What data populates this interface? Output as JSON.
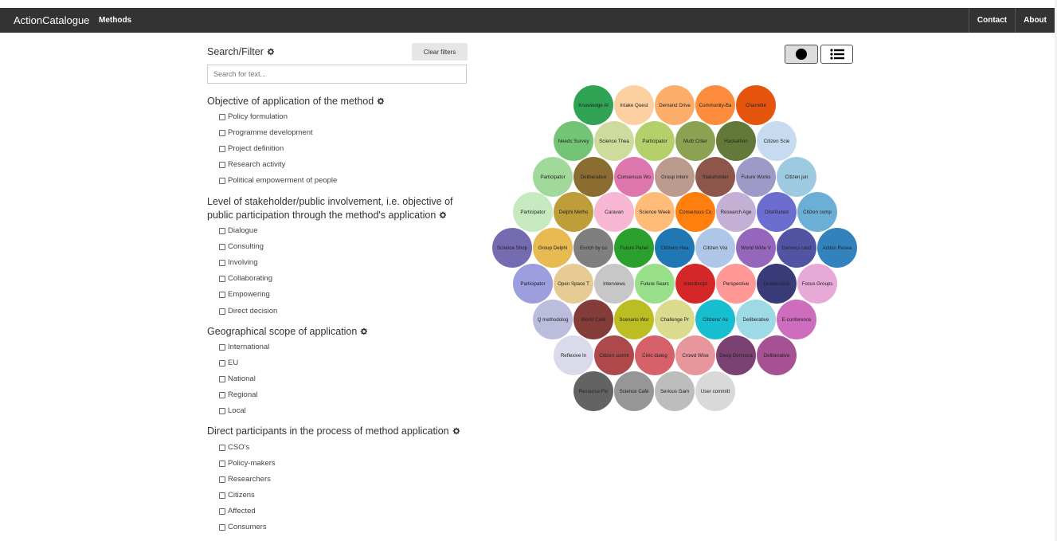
{
  "navbar": {
    "brand": "ActionCatalogue",
    "methods": "Methods",
    "contact": "Contact",
    "about": "About"
  },
  "filter": {
    "title": "Search/Filter",
    "clear": "Clear filters",
    "search_placeholder": "Search for text..."
  },
  "sections": [
    {
      "title": "Objective of application of the method",
      "options": [
        "Policy formulation",
        "Programme development",
        "Project definition",
        "Research activity",
        "Political empowerment of people"
      ]
    },
    {
      "title_line1": "Level of stakeholder/public involvement, i.e. objective of",
      "title_line2": "public participation through the method's application",
      "options": [
        "Dialogue",
        "Consulting",
        "Involving",
        "Collaborating",
        "Empowering",
        "Direct decision"
      ]
    },
    {
      "title": "Geographical scope of application",
      "options": [
        "International",
        "EU",
        "National",
        "Regional",
        "Local"
      ]
    },
    {
      "title": "Direct participants in the process of method application",
      "options": [
        "CSO's",
        "Policy-makers",
        "Researchers",
        "Citizens",
        "Affected",
        "Consumers"
      ]
    }
  ],
  "view_toggle": {
    "bubble_icon": "circle-icon",
    "list_icon": "list-icon"
  },
  "bubbles": {
    "rows": [
      [
        [
          "Knowledge Al",
          "#31a354"
        ],
        [
          "Intake Quest",
          "#fdd0a2"
        ],
        [
          "Demand Drive",
          "#fdae6b"
        ],
        [
          "Community-Ba",
          "#fd8d3c"
        ],
        [
          "Charrette",
          "#e6550d"
        ]
      ],
      [
        [
          "Needs Survey",
          "#74c476"
        ],
        [
          "Science Thea",
          "#cedb9c"
        ],
        [
          "Participator",
          "#b5cf6b"
        ],
        [
          "Multi Criter",
          "#8ca252"
        ],
        [
          "Hackathon",
          "#637939"
        ],
        [
          "Citizen Scie",
          "#c6dbef"
        ]
      ],
      [
        [
          "Participator",
          "#a1d99b"
        ],
        [
          "Deliberative",
          "#8c6d31"
        ],
        [
          "Consensus Wo",
          "#de77ae"
        ],
        [
          "Group interv",
          "#bc9b8f"
        ],
        [
          "Stakeholder",
          "#8c564b"
        ],
        [
          "Future Works",
          "#9e9ac8"
        ],
        [
          "Citizen jun",
          "#9ecae1"
        ]
      ],
      [
        [
          "Participator",
          "#c7e9c0"
        ],
        [
          "Delphi Metho",
          "#bd9e39"
        ],
        [
          "Caravan",
          "#f7b6d2"
        ],
        [
          "Science Week",
          "#ffbb78"
        ],
        [
          "Consensus Co",
          "#ff7f0e"
        ],
        [
          "Research Age",
          "#c5b0d5"
        ],
        [
          "Distributed",
          "#6b6ecf"
        ],
        [
          "Citizen comp",
          "#6baed6"
        ]
      ],
      [
        [
          "Science Shop",
          "#756bb1"
        ],
        [
          "Group Delphi",
          "#e7ba52"
        ],
        [
          "Enrich by co",
          "#7f7f7f"
        ],
        [
          "Future Panel",
          "#2ca02c"
        ],
        [
          "Citizens Hea",
          "#1f77b4"
        ],
        [
          "Citizen Visi",
          "#aec7e8"
        ],
        [
          "World Wide V",
          "#9467bd"
        ],
        [
          "Democs card",
          "#5254a3"
        ],
        [
          "Action Resea",
          "#3182bd"
        ]
      ],
      [
        [
          "Participator",
          "#9c9ede"
        ],
        [
          "Open Space T",
          "#e7cb94"
        ],
        [
          "Interviews",
          "#c7c7c7"
        ],
        [
          "Future Searc",
          "#98df8a"
        ],
        [
          "Interdiscipl",
          "#d62728"
        ],
        [
          "Perspective",
          "#ff9896"
        ],
        [
          "Deliberative",
          "#393b79"
        ],
        [
          "Focus Groups",
          "#e7a9d8"
        ]
      ],
      [
        [
          "Q methodolog",
          "#bcbddc"
        ],
        [
          "World Café",
          "#843c39"
        ],
        [
          "Scenario Wor",
          "#bcbd22"
        ],
        [
          "Challenge Pr",
          "#dbdb8d"
        ],
        [
          "Citizens' As",
          "#17becf"
        ],
        [
          "Deliberative",
          "#9edae5"
        ],
        [
          "E-conference",
          "#ce6dbd"
        ]
      ],
      [
        [
          "Reflexive In",
          "#dadaeb"
        ],
        [
          "Citizen summ",
          "#ad494a"
        ],
        [
          "Civic dialog",
          "#d6616b"
        ],
        [
          "Crowd Wise",
          "#e7969c"
        ],
        [
          "Deep Democra",
          "#7b4173"
        ],
        [
          "Deliberative",
          "#a55194"
        ]
      ],
      [
        [
          "Resource Flo",
          "#636363"
        ],
        [
          "Science Café",
          "#969696"
        ],
        [
          "Serious Gam",
          "#bdbdbd"
        ],
        [
          "User committ",
          "#d9d9d9"
        ]
      ]
    ]
  }
}
